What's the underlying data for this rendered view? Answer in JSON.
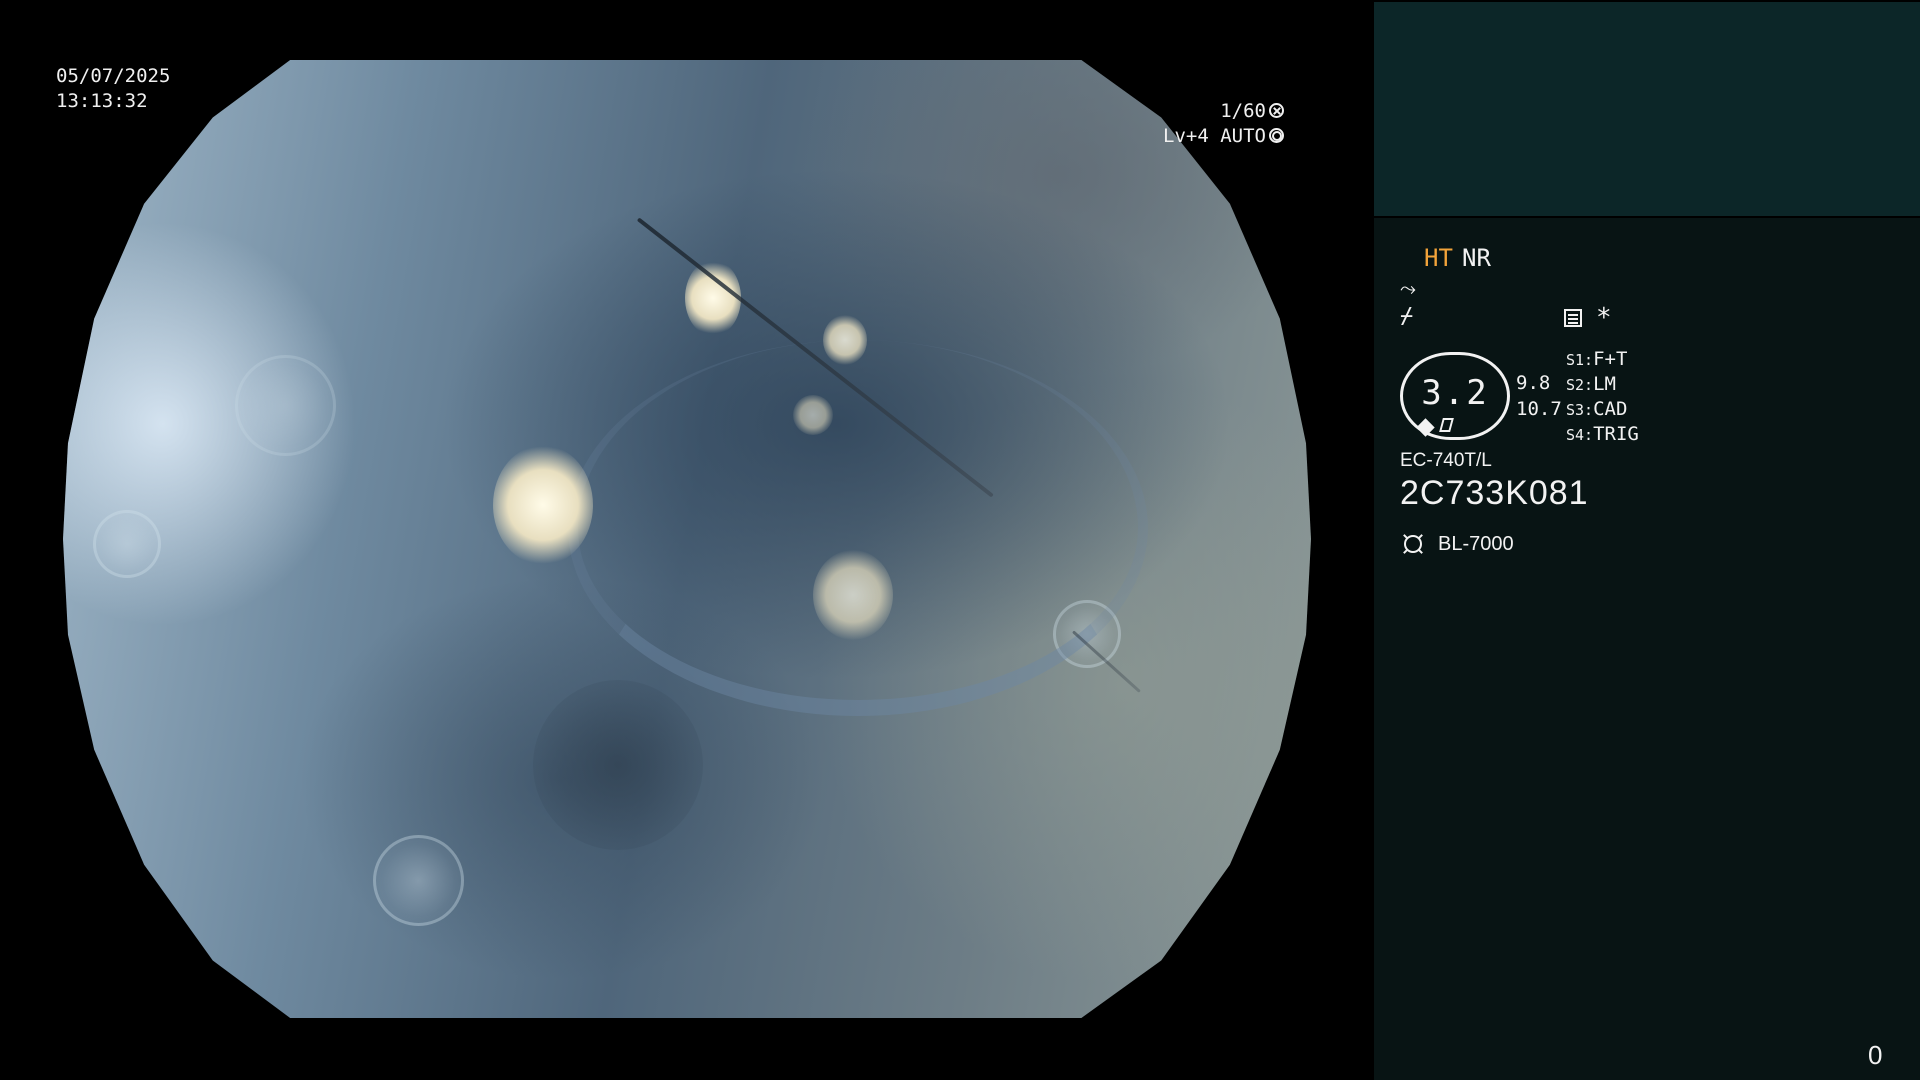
{
  "overlay": {
    "date": "05/07/2025",
    "time": "13:13:32",
    "shutter": "1/60",
    "level": "Lv+4 AUTO"
  },
  "panel": {
    "ht": "HT",
    "nr": "NR",
    "enhance_glyph": "⤳",
    "color_glyph": "⌿",
    "asterisk": "*",
    "zoom": {
      "value": "3.2",
      "near": "9.8",
      "far": "10.7"
    },
    "switches": [
      {
        "key": "S1:",
        "value": "F+T"
      },
      {
        "key": "S2:",
        "value": "LM"
      },
      {
        "key": "S3:",
        "value": "CAD"
      },
      {
        "key": "S4:",
        "value": "TRIG"
      }
    ],
    "scope_model": "EC-740T/L",
    "scope_serial": "2C733K081",
    "light_source": "BL-7000",
    "counter": "0"
  },
  "colors": {
    "ht_accent": "#f2a33a",
    "panel_bg": "#081414",
    "thumb_bg": "#0c2628"
  },
  "icons": {
    "shutter": "shutter-icon",
    "iris": "iris-icon",
    "enhance": "structure-enhance-icon",
    "color": "color-mode-icon",
    "memo": "memo-icon",
    "light": "light-source-icon"
  }
}
